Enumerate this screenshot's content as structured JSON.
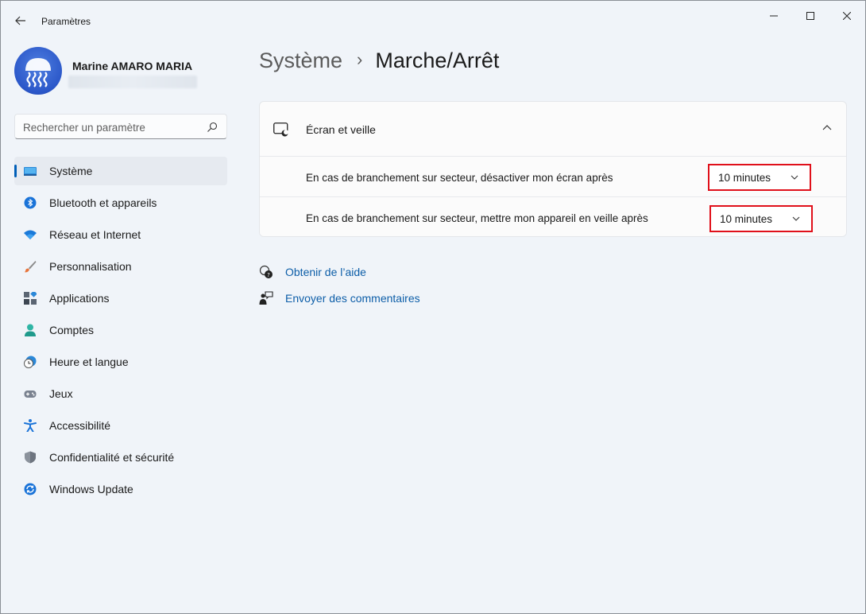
{
  "app": {
    "title": "Paramètres"
  },
  "profile": {
    "name": "Marine AMARO MARIA"
  },
  "search": {
    "placeholder": "Rechercher un paramètre"
  },
  "sidebar": {
    "items": [
      {
        "label": "Système",
        "icon": "system-display-icon",
        "active": true
      },
      {
        "label": "Bluetooth et appareils",
        "icon": "bluetooth-icon"
      },
      {
        "label": "Réseau et Internet",
        "icon": "wifi-icon"
      },
      {
        "label": "Personnalisation",
        "icon": "paintbrush-icon"
      },
      {
        "label": "Applications",
        "icon": "apps-icon"
      },
      {
        "label": "Comptes",
        "icon": "account-icon"
      },
      {
        "label": "Heure et langue",
        "icon": "clock-globe-icon"
      },
      {
        "label": "Jeux",
        "icon": "gamepad-icon"
      },
      {
        "label": "Accessibilité",
        "icon": "accessibility-icon"
      },
      {
        "label": "Confidentialité et sécurité",
        "icon": "shield-icon"
      },
      {
        "label": "Windows Update",
        "icon": "update-icon"
      }
    ]
  },
  "breadcrumb": {
    "parent": "Système",
    "separator": "›",
    "current": "Marche/Arrêt"
  },
  "screen_sleep": {
    "title": "Écran et veille",
    "rows": [
      {
        "label": "En cas de branchement sur secteur, désactiver mon écran après",
        "value": "10 minutes"
      },
      {
        "label": "En cas de branchement sur secteur, mettre mon appareil en veille après",
        "value": "10 minutes"
      }
    ]
  },
  "links": {
    "help": "Obtenir de l’aide",
    "feedback": "Envoyer des commentaires"
  },
  "colors": {
    "accent": "#005fb8",
    "highlight": "#e0101a",
    "link": "#0d5ea8"
  }
}
